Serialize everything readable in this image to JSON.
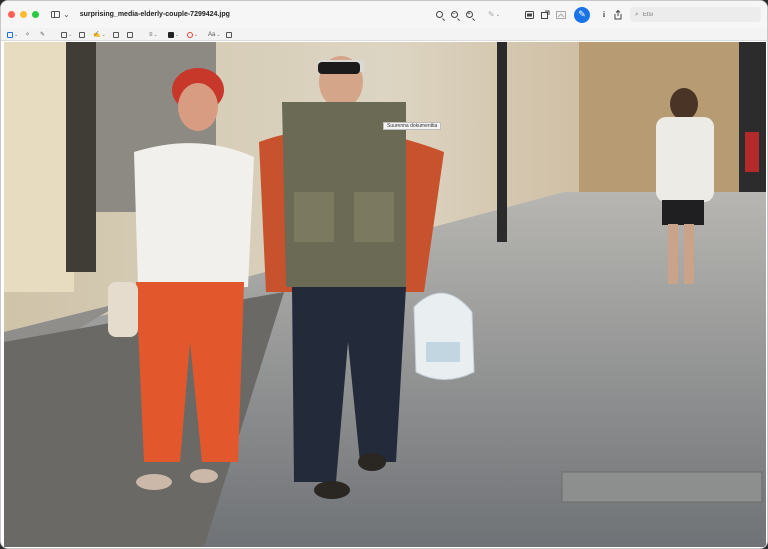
{
  "window": {
    "title": "surprising_media-elderly-couple-7299424.jpg"
  },
  "titlebar": {
    "search_placeholder": "Etsi",
    "markup_button_glyph": "✎",
    "info_glyph": "i"
  },
  "markup_toolbar": {
    "text_style_label": "Aa"
  },
  "image": {
    "tooltip": "Suurenna dokumenttia"
  },
  "colors": {
    "accent": "#1a73e8",
    "window_bg": "#f6f6f6"
  }
}
